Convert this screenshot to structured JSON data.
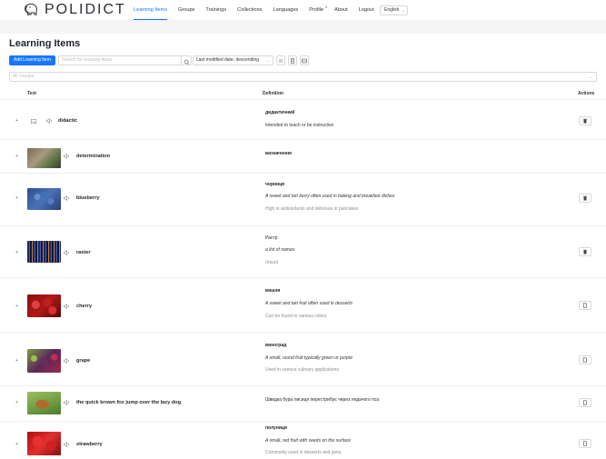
{
  "app": {
    "logo_text": "POLIDICT"
  },
  "nav": {
    "items": [
      {
        "label": "Learning Items"
      },
      {
        "label": "Groups"
      },
      {
        "label": "Trainings"
      },
      {
        "label": "Collections"
      },
      {
        "label": "Languages"
      },
      {
        "label": "Profile",
        "badge": "2"
      },
      {
        "label": "About"
      },
      {
        "label": "Logout"
      }
    ],
    "language": "English"
  },
  "page": {
    "title": "Learning Items"
  },
  "toolbar": {
    "add_label": "Add Learning Item",
    "search_placeholder": "Search for learning items",
    "sort_value": "Last modified date, descending"
  },
  "group_filter": {
    "placeholder": "All Groups"
  },
  "table": {
    "headers": {
      "text": "Text",
      "definition": "Definition",
      "actions": "Actions"
    },
    "rows": [
      {
        "word": "didactic",
        "translation": "дидактичний",
        "definition": "Intended to teach or be instructive",
        "note": ""
      },
      {
        "word": "determination",
        "translation": "визначення",
        "definition": "",
        "note": ""
      },
      {
        "word": "blueberry",
        "translation": "чорниця",
        "definition": "A sweet and tart berry often used in baking and breakfast dishes",
        "note": "High in antioxidants and delicious in pancakes"
      },
      {
        "word": "raster",
        "translation": "Растр",
        "definition": "a list of names",
        "note": "(noun)"
      },
      {
        "word": "cherry",
        "translation": "вишня",
        "definition": "A sweet and tart fruit often used in desserts",
        "note": "Can be found in various colors"
      },
      {
        "word": "grape",
        "translation": "виноград",
        "definition": "A small, round fruit typically green or purple",
        "note": "Used in various culinary applications"
      },
      {
        "word": "the quick brown fox jump over the lazy dog",
        "translation": "Швидка бура лисиця перестрибує через ледачого пса",
        "definition": "",
        "note": ""
      },
      {
        "word": "strawberry",
        "translation": "полуниця",
        "definition": "A small, red fruit with seeds on the surface",
        "note": "Commonly used in desserts and jams"
      }
    ]
  },
  "colors": {
    "accent": "#1677ff",
    "border": "#d9d9d9",
    "muted": "#8c8c8c"
  }
}
